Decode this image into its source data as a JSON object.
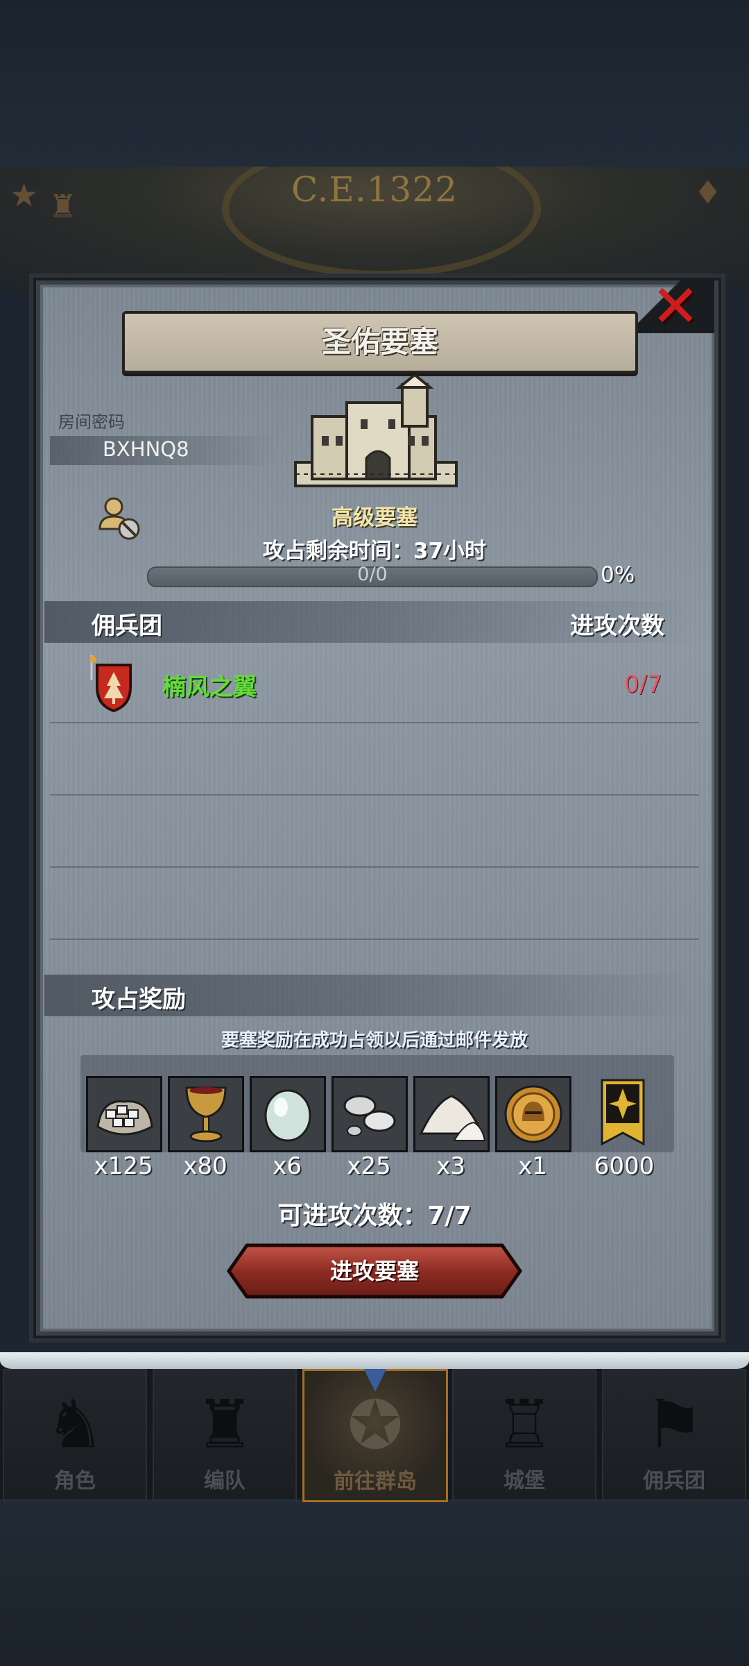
{
  "header": {
    "year_label": "C.E.1322"
  },
  "dialog": {
    "title": "圣佑要塞",
    "close_icon": "close-x-icon",
    "room": {
      "label": "房间密码",
      "code": "BXHNQ8"
    },
    "fortress": {
      "type_label": "高级要塞",
      "time_remaining": "攻占剩余时间：37小时"
    },
    "progress": {
      "value_text": "0/0",
      "percent_text": "0%",
      "fraction": 0
    },
    "guild_section": {
      "title": "佣兵团",
      "attacks_header": "进攻次数",
      "rows": [
        {
          "name": "楠风之翼",
          "attacks": "0/7"
        }
      ]
    },
    "rewards": {
      "title": "攻占奖励",
      "note": "要塞奖励在成功占领以后通过邮件发放",
      "items": [
        {
          "icon": "silver-ore-bag-icon",
          "count": "x125"
        },
        {
          "icon": "goblet-icon",
          "count": "x80"
        },
        {
          "icon": "moonstone-icon",
          "count": "x6"
        },
        {
          "icon": "silver-ingots-icon",
          "count": "x25"
        },
        {
          "icon": "salt-pile-icon",
          "count": "x3"
        },
        {
          "icon": "knight-medal-icon",
          "count": "x1"
        },
        {
          "icon": "honor-banner-icon",
          "count": "6000"
        }
      ]
    },
    "attempts": "可进攻次数：7/7",
    "attack_button": "进攻要塞"
  },
  "bottom_nav": {
    "items": [
      {
        "label": "角色",
        "icon": "knight-bust-icon",
        "active": false
      },
      {
        "label": "编队",
        "icon": "formation-helmet-icon",
        "active": false
      },
      {
        "label": "前往群岛",
        "icon": "compass-island-icon",
        "active": true
      },
      {
        "label": "城堡",
        "icon": "castle-icon",
        "active": false
      },
      {
        "label": "佣兵团",
        "icon": "mercenary-flag-icon",
        "active": false
      }
    ]
  }
}
